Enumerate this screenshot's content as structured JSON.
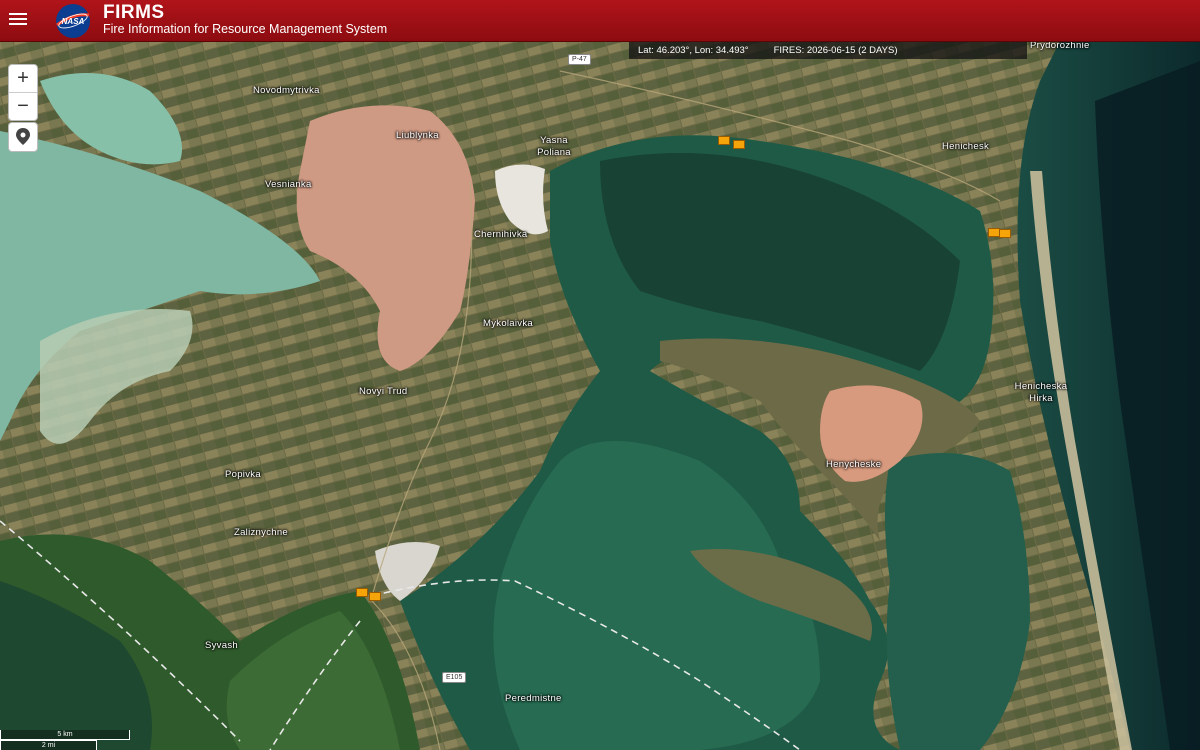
{
  "header": {
    "title": "FIRMS",
    "subtitle": "Fire Information for Resource Management System",
    "logo_text": "NASA",
    "menu_icon": "hamburger-icon"
  },
  "infobar": {
    "coords": "Lat: 46.203°, Lon: 34.493°",
    "fires": "FIRES: 2026-06-15 (2 DAYS)"
  },
  "controls": {
    "zoom_in": "+",
    "zoom_out": "−",
    "locate_icon": "location-pin-icon"
  },
  "places": [
    {
      "name": "Novodmytrivka"
    },
    {
      "name": "Liublynka"
    },
    {
      "name": "Yasna\nPoliana"
    },
    {
      "name": "Vesnianka"
    },
    {
      "name": "Chernihivka"
    },
    {
      "name": "Mykolaivka"
    },
    {
      "name": "Novyi Trud"
    },
    {
      "name": "Popivka"
    },
    {
      "name": "Zaliznychne"
    },
    {
      "name": "Syvash"
    },
    {
      "name": "Peredmistne"
    },
    {
      "name": "Henichesk"
    },
    {
      "name": "Henicheska\nHirka"
    },
    {
      "name": "Henycheske"
    },
    {
      "name": "Prydorozhnie"
    }
  ],
  "roads": [
    {
      "name": "P-47"
    },
    {
      "name": "E105"
    }
  ],
  "scale": {
    "km": "5 km",
    "mi": "2 mi"
  },
  "fire_count": 6,
  "colors": {
    "header": "#a3111a",
    "fire": "#f5a40a"
  }
}
